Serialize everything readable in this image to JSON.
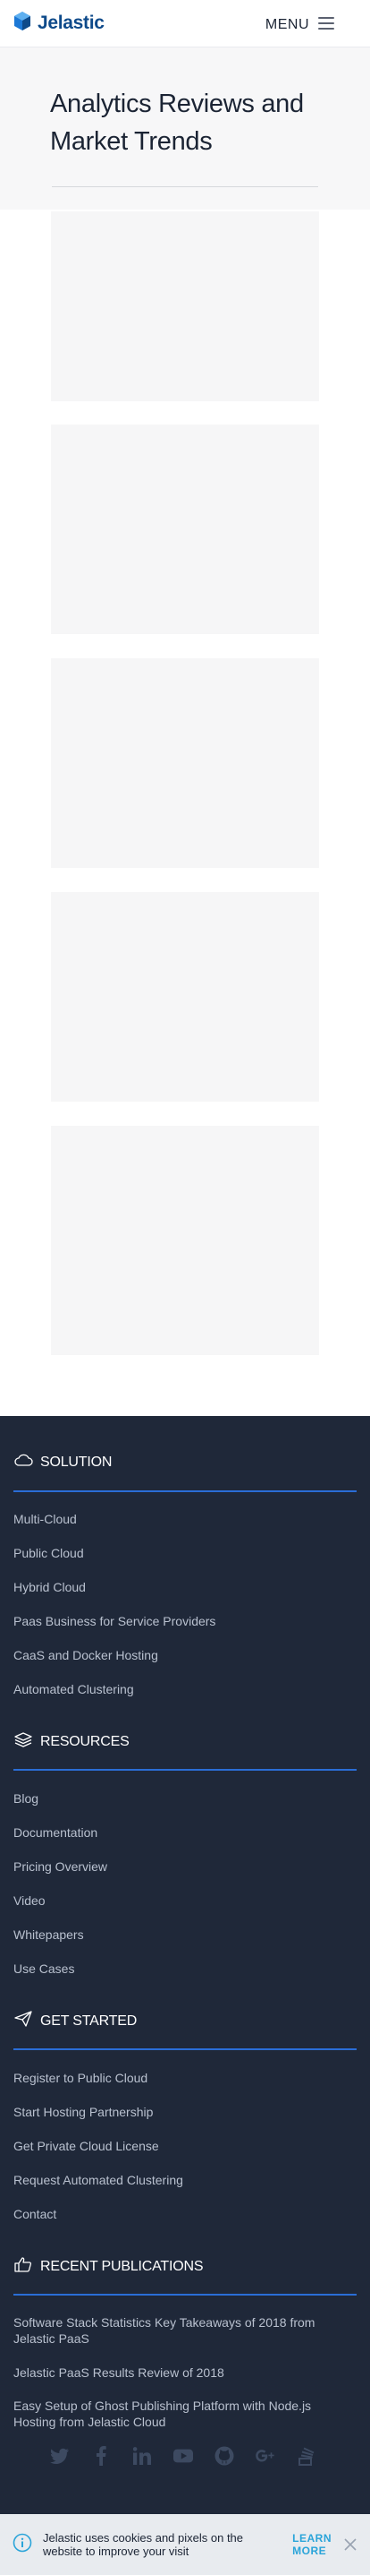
{
  "header": {
    "logo_text": "Jelastic",
    "menu_label": "MENU"
  },
  "hero": {
    "title": "Analytics Reviews and Market Trends"
  },
  "footer": {
    "sections": [
      {
        "title": "SOLUTION",
        "icon": "cloud-icon",
        "links": [
          "Multi-Cloud",
          "Public Cloud",
          "Hybrid Cloud",
          "Paas Business for Service Providers",
          "CaaS and Docker Hosting",
          "Automated Clustering"
        ]
      },
      {
        "title": "RESOURCES",
        "icon": "layers-icon",
        "links": [
          "Blog",
          "Documentation",
          "Pricing Overview",
          "Video",
          "Whitepapers",
          "Use Cases"
        ]
      },
      {
        "title": "GET STARTED",
        "icon": "paper-plane-icon",
        "links": [
          "Register to Public Cloud",
          "Start Hosting Partnership",
          "Get Private Cloud License",
          "Request Automated Clustering",
          "Contact"
        ]
      },
      {
        "title": "RECENT PUBLICATIONS",
        "icon": "thumbs-up-icon",
        "links": [
          "Software Stack Statistics Key Takeaways of 2018 from Jelastic PaaS",
          "Jelastic PaaS Results Review of 2018",
          "Easy Setup of Ghost Publishing Platform with Node.js Hosting from Jelastic Cloud"
        ]
      }
    ],
    "socials": [
      "twitter-icon",
      "facebook-icon",
      "linkedin-icon",
      "youtube-icon",
      "github-icon",
      "google-plus-icon",
      "stackshare-icon"
    ]
  },
  "cookie": {
    "text": "Jelastic uses cookies and pixels on the website to improve your visit",
    "learn_more": "LEARN MORE"
  },
  "colors": {
    "footer_bg": "#1f2839",
    "accent_rule": "#2a6dd6",
    "brand_blue": "#0e4a8a",
    "link_cyan": "#2aa4d9"
  }
}
